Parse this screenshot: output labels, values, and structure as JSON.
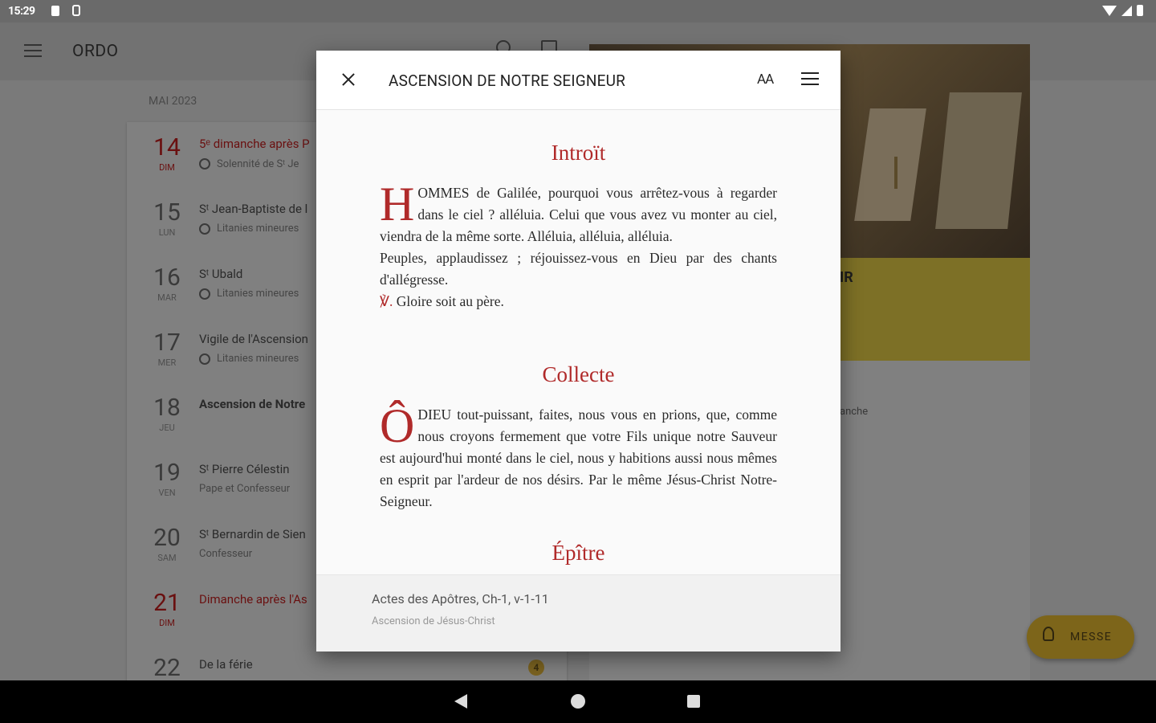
{
  "status_bar": {
    "time": "15:29"
  },
  "app_bar": {
    "title": "ORDO"
  },
  "calendar": {
    "month": "MAI 2023",
    "days": [
      {
        "num": "14",
        "weekday": "DIM",
        "title": "5ᵉ dimanche après P",
        "sub": "Solennité de Sᵗ Je",
        "red": true,
        "icon": "clock-icon"
      },
      {
        "num": "15",
        "weekday": "LUN",
        "title": "Sᵗ Jean-Baptiste de l",
        "sub": "Litanies mineures",
        "red": false,
        "icon": "clock-icon"
      },
      {
        "num": "16",
        "weekday": "MAR",
        "title": "Sᵗ Ubald",
        "sub": "Litanies mineures",
        "red": false,
        "icon": "clock-icon"
      },
      {
        "num": "17",
        "weekday": "MER",
        "title": "Vigile de l'Ascension",
        "sub": "Litanies mineures",
        "red": false,
        "icon": "clock-icon"
      },
      {
        "num": "18",
        "weekday": "JEU",
        "title": "Ascension de Notre",
        "sub": "",
        "red": false,
        "bold": true
      },
      {
        "num": "19",
        "weekday": "VEN",
        "title": "Sᵗ Pierre Célestin",
        "sub": "Pape et Confesseur",
        "red": false
      },
      {
        "num": "20",
        "weekday": "SAM",
        "title": "Sᵗ Bernardin de Sien",
        "sub": "Confesseur",
        "red": false
      },
      {
        "num": "21",
        "weekday": "DIM",
        "title": "Dimanche après l'As",
        "sub": "",
        "red": true
      },
      {
        "num": "22",
        "weekday": "",
        "title": "De la férie",
        "sub": "",
        "red": false,
        "badge": "4"
      }
    ]
  },
  "detail": {
    "band_text": "IR",
    "side_text": "anche"
  },
  "fab": {
    "label": "MESSE",
    "icon": "chalice-icon"
  },
  "dialog": {
    "title": "ASCENSION DE NOTRE SEIGNEUR",
    "text_size_label": "AA",
    "sections": [
      {
        "heading": "Introït",
        "dropcap": "H",
        "paragraph": "OMMES de Galilée, pourquoi vous arrêtez-vous à regarder dans le ciel ? alléluia. Celui que vous avez vu monter au ciel, viendra de la même sorte. Alléluia, alléluia, alléluia.",
        "paragraph2": "Peuples, applaudissez ; réjouissez-vous en Dieu par des chants d'allégresse.",
        "versicle_mark": "℣.",
        "versicle_text": " Gloire soit au père."
      },
      {
        "heading": "Collecte",
        "dropcap": "Ô",
        "paragraph": "DIEU tout-puissant, faites, nous vous en prions, que, comme nous croyons fermement que votre Fils unique notre Sauveur est aujourd'hui monté dans le ciel, nous y habitions aussi nous mêmes en esprit par l'ardeur de nos désirs. Par le même Jésus-Christ Notre-Seigneur."
      },
      {
        "heading": "Épître"
      }
    ],
    "footer": {
      "reference": "Actes des Apôtres, Ch-1, v-1-11",
      "subtitle": "Ascension de Jésus-Christ"
    }
  }
}
